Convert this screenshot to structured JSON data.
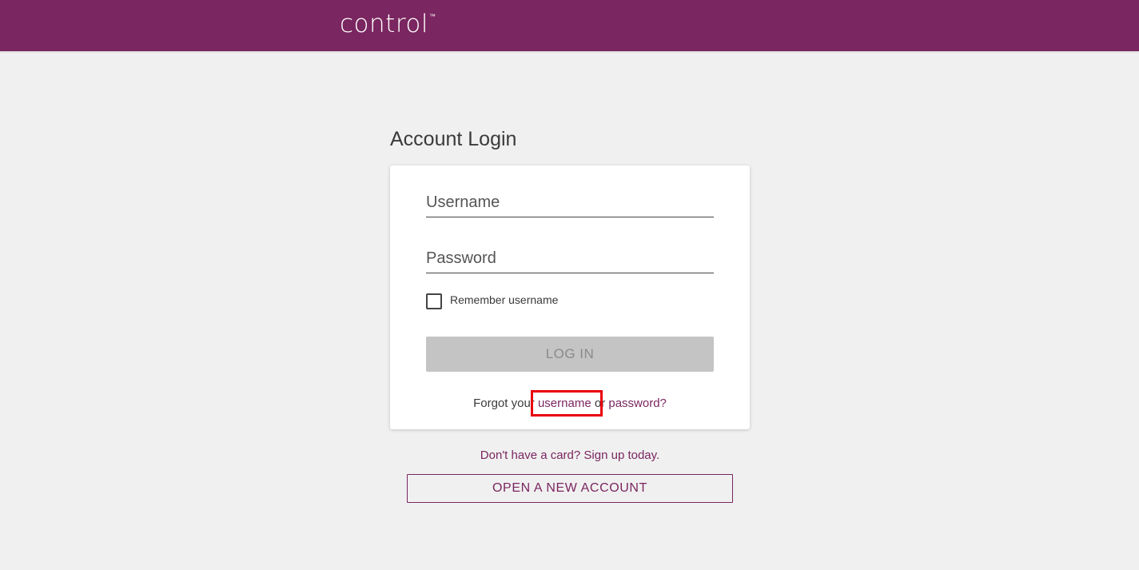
{
  "header": {
    "logo_text": "control",
    "trademark": "™",
    "brand_color": "#7a2660"
  },
  "login": {
    "title": "Account Login",
    "username_placeholder": "Username",
    "password_placeholder": "Password",
    "remember_label": "Remember username",
    "remember_checked": false,
    "login_button": "LOG IN",
    "forgot_prefix": "Forgot your",
    "forgot_username": "username",
    "forgot_or": "or",
    "forgot_password": "password?"
  },
  "footer": {
    "signup_text": "Don't have a card? Sign up today.",
    "open_account_button": "OPEN A NEW ACCOUNT"
  },
  "annotation": {
    "highlight_color": "#e8000b"
  }
}
